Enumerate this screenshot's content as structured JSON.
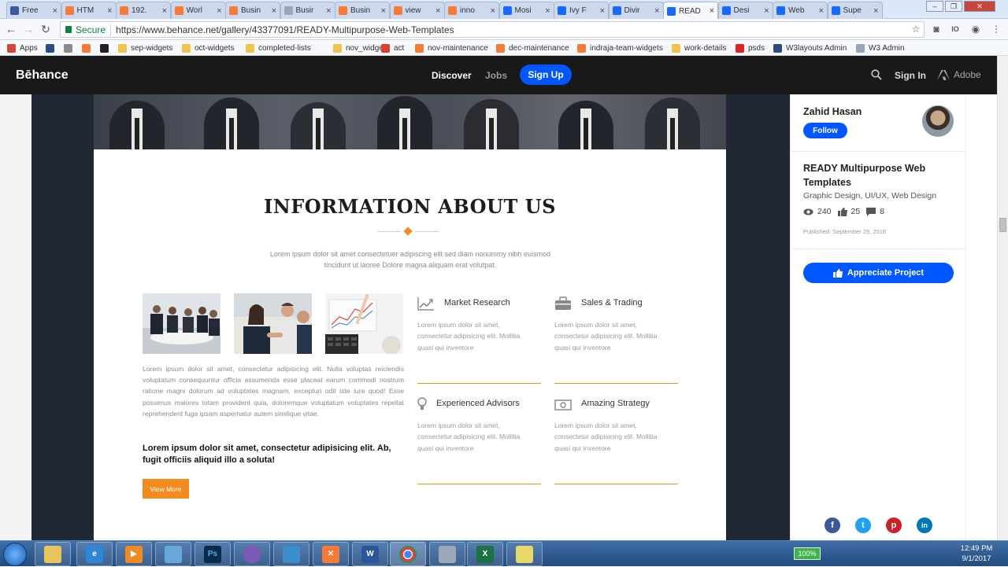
{
  "browser": {
    "tabs": [
      {
        "label": "Free",
        "icon": "w3-icon",
        "color": "#3a5a9a"
      },
      {
        "label": "HTM",
        "icon": "xampp-icon",
        "color": "#f57b36"
      },
      {
        "label": "192.",
        "icon": "xampp-icon",
        "color": "#f57b36"
      },
      {
        "label": "Worl",
        "icon": "xampp-icon",
        "color": "#f57b36"
      },
      {
        "label": "Busin",
        "icon": "xampp-icon",
        "color": "#f57b36"
      },
      {
        "label": "Busir",
        "icon": "page-icon",
        "color": "#9aa6b6"
      },
      {
        "label": "Busin",
        "icon": "xampp-icon",
        "color": "#f57b36"
      },
      {
        "label": "view",
        "icon": "xampp-icon",
        "color": "#f57b36"
      },
      {
        "label": "inno",
        "icon": "xampp-icon",
        "color": "#f57b36"
      },
      {
        "label": "Mosi",
        "icon": "behance-icon",
        "color": "#1769ff"
      },
      {
        "label": "Ivy F",
        "icon": "behance-icon",
        "color": "#1769ff"
      },
      {
        "label": "Divir",
        "icon": "behance-icon",
        "color": "#1769ff"
      },
      {
        "label": "READ",
        "icon": "behance-icon",
        "color": "#1769ff"
      },
      {
        "label": "Desi",
        "icon": "behance-icon",
        "color": "#1769ff"
      },
      {
        "label": "Web",
        "icon": "behance-icon",
        "color": "#1769ff"
      },
      {
        "label": "Supe",
        "icon": "behance-icon",
        "color": "#1769ff"
      }
    ],
    "active_tab_index": 12,
    "secure_label": "Secure",
    "url": "https://www.behance.net/gallery/43377091/READY-Multipurpose-Web-Templates",
    "bookmarks": [
      {
        "label": "Apps",
        "icon": "apps-grid-icon",
        "color": "#d6453d"
      },
      {
        "label": "",
        "icon": "w3-icon",
        "color": "#2b4c7e"
      },
      {
        "label": "",
        "icon": "r-icon",
        "color": "#8a8a8a"
      },
      {
        "label": "",
        "icon": "q-icon",
        "color": "#f57b36"
      },
      {
        "label": "",
        "icon": "github-icon",
        "color": "#222222"
      },
      {
        "label": "sep-widgets",
        "icon": "folder-icon",
        "color": "#f2c24c"
      },
      {
        "label": "oct-widgets",
        "icon": "folder-icon",
        "color": "#f2c24c"
      },
      {
        "label": "completed-lists",
        "icon": "folder-icon",
        "color": "#f2c24c"
      },
      {
        "label": "nov_widgets",
        "icon": "folder-icon",
        "color": "#f2c24c"
      },
      {
        "label": "act",
        "icon": "act-icon",
        "color": "#d84030"
      },
      {
        "label": "nov-maintenance",
        "icon": "xampp-icon",
        "color": "#f57b36"
      },
      {
        "label": "dec-maintenance",
        "icon": "xampp-icon",
        "color": "#f57b36"
      },
      {
        "label": "indraja-team-widgets",
        "icon": "xampp-icon",
        "color": "#f57b36"
      },
      {
        "label": "work-details",
        "icon": "folder-icon",
        "color": "#f2c24c"
      },
      {
        "label": "psds",
        "icon": "diamond-icon",
        "color": "#e02020"
      },
      {
        "label": "W3layouts Admin",
        "icon": "w3-icon",
        "color": "#2b4c7e"
      },
      {
        "label": "W3 Admin",
        "icon": "page-icon",
        "color": "#9aa6b6"
      }
    ]
  },
  "behance": {
    "logo": "Bēhance",
    "nav_discover": "Discover",
    "nav_jobs": "Jobs",
    "signup": "Sign Up",
    "signin": "Sign In",
    "adobe": "Adobe"
  },
  "project": {
    "headline": "INFORMATION ABOUT US",
    "intro": "Lorem ipsum dolor sit amet consectetuer adipiscing elit sed diam nonummy nibh euismod tincidunt ut laoree Dolore magna aliquam erat volutpat.",
    "body": "Lorem ipsum dolor sit amet, consectetur adipisicing elit. Nulla voluptas reiciendis voluptatum consequuntur officia assumenda esse placeat earum commodi nostrum ratione magni dolorum ad voluptates magnam, excepturi odit iste iure quod! Esse possimus maiores totam provident quia, doloremque voluptatum voluptates repellat reprehenderit fuga ipsam aspernatur autem similique vitae.",
    "bold": "Lorem ipsum dolor sit amet, consectetur adipisicing elit. Ab, fugit officiis aliquid illo a soluta!",
    "view_more": "View More",
    "features": [
      {
        "title": "Market Research",
        "icon": "chart-line-icon",
        "desc": "Lorem ipsum dolor sit amet, consectetur adipisicing elit. Mollitia quasi qui inventore"
      },
      {
        "title": "Sales & Trading",
        "icon": "briefcase-icon",
        "desc": "Lorem ipsum dolor sit amet, consectetur adipisicing elit. Mollitia quasi qui inventore"
      },
      {
        "title": "Experienced Advisors",
        "icon": "lightbulb-icon",
        "desc": "Lorem ipsum dolor sit amet, consectetur adipisicing elit. Mollitia quasi qui inventore"
      },
      {
        "title": "Amazing Strategy",
        "icon": "money-icon",
        "desc": "Lorem ipsum dolor sit amet, consectetur adipisicing elit. Mollitia quasi qui inventore"
      }
    ],
    "accent": "#f38b1f"
  },
  "sidebar": {
    "owner": "Zahid Hasan",
    "follow": "Follow",
    "title": "READY Multipurpose Web Templates",
    "tags": "Graphic Design, UI/UX, Web Design",
    "views": "240",
    "likes": "25",
    "comments": "8",
    "published": "Published: September 29, 2016",
    "appreciate": "Appreciate Project",
    "brand_color": "#0057ff"
  },
  "taskbar": {
    "battery": "100%",
    "time": "12:49 PM",
    "date": "9/1/2017"
  }
}
